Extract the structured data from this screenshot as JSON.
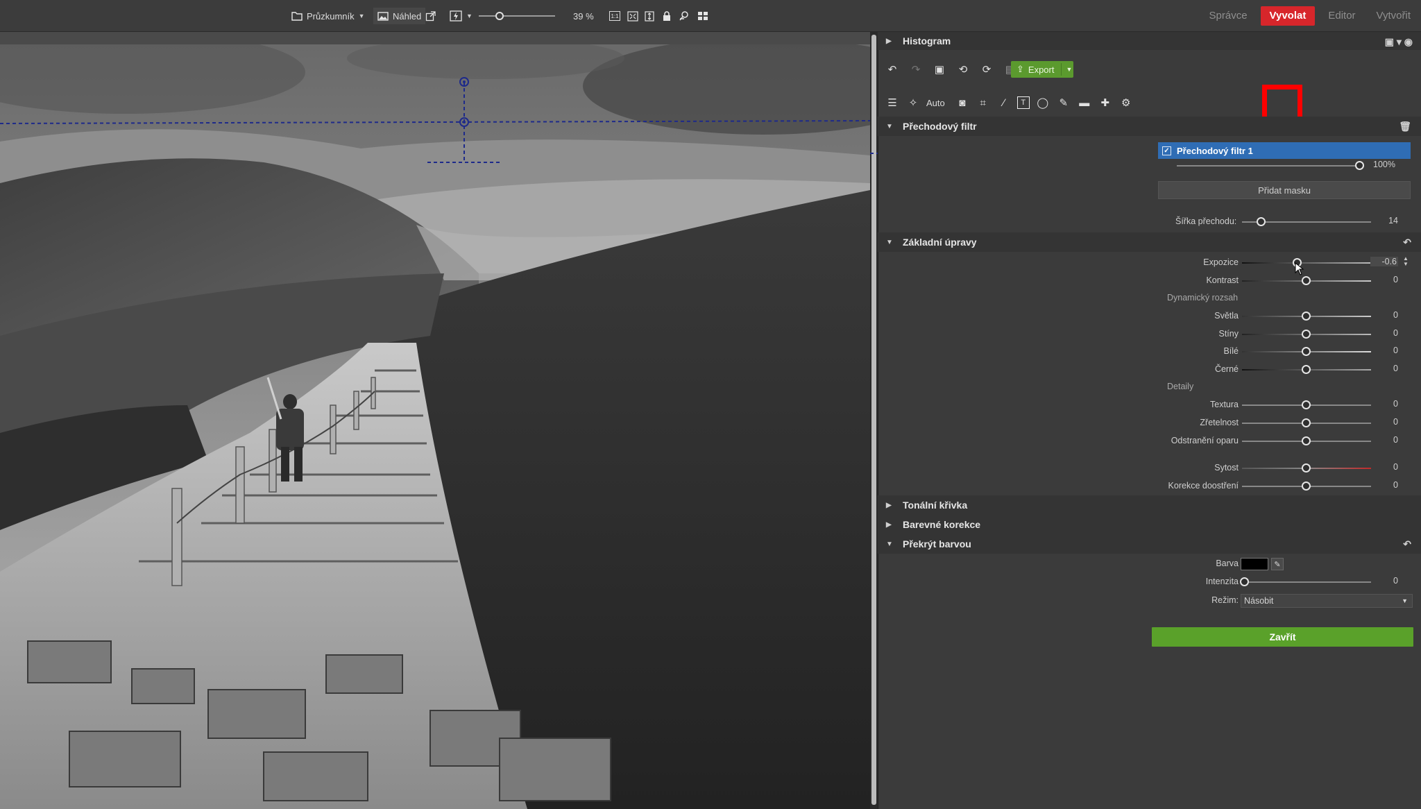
{
  "toolbar": {
    "browser_label": "Průzkumník",
    "preview_label": "Náhled",
    "zoom_label": "39 %",
    "ratio_label": "1:1"
  },
  "mode_tabs": [
    "Správce",
    "Vyvolat",
    "Editor",
    "Vytvořit"
  ],
  "active_mode": "Vyvolat",
  "panel": {
    "histogram_title": "Histogram",
    "export_label": "Export",
    "auto_label": "Auto",
    "gradient_section": "Přechodový filtr",
    "filter_item_label": "Přechodový filtr 1",
    "filter_opacity": "100%",
    "add_mask_label": "Přidat masku",
    "transition_width_label": "Šířka přechodu:",
    "transition_width_value": "14",
    "basic_section": "Základní úpravy",
    "exposure_label": "Expozice",
    "exposure_value": "-0.6",
    "contrast_label": "Kontrast",
    "contrast_value": "0",
    "dynamic_range_label": "Dynamický rozsah",
    "highlights_label": "Světla",
    "highlights_value": "0",
    "shadows_label": "Stíny",
    "shadows_value": "0",
    "whites_label": "Bílé",
    "whites_value": "0",
    "blacks_label": "Černé",
    "blacks_value": "0",
    "details_label": "Detaily",
    "texture_label": "Textura",
    "texture_value": "0",
    "clarity_label": "Zřetelnost",
    "clarity_value": "0",
    "dehaze_label": "Odstranění oparu",
    "dehaze_value": "0",
    "saturation_label": "Sytost",
    "saturation_value": "0",
    "sharpen_label": "Korekce doostření",
    "sharpen_value": "0",
    "tone_curve_section": "Tonální křivka",
    "color_corrections_section": "Barevné korekce",
    "color_overlay_section": "Překrýt barvou",
    "color_label": "Barva",
    "intensity_label": "Intenzita",
    "intensity_value": "0",
    "mode_label": "Režim:",
    "mode_value": "Násobit",
    "close_label": "Zavřít"
  },
  "colors": {
    "accent_red": "#d7262b",
    "selection_blue": "#2f6db5",
    "confirm_green": "#5aa12a",
    "saturation_red": "#c22a2a",
    "highlight_box": "#ff0000"
  },
  "slider_positions": {
    "filter_opacity": 1.0,
    "transition_width": 0.14,
    "exposure": 0.43,
    "neutral": 0.5,
    "intensity": 0.0
  }
}
